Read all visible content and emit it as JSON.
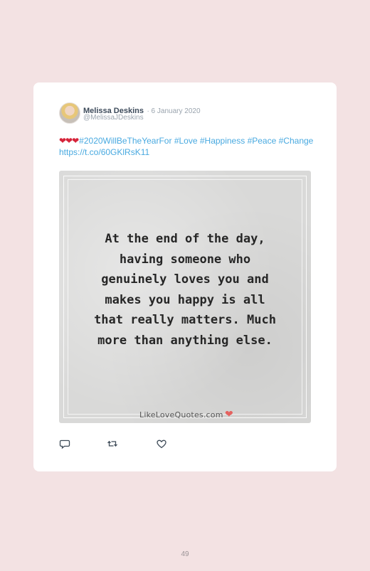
{
  "tweet": {
    "author_name": "Melissa Deskins",
    "date": "· 6 January 2020",
    "handle": "@MelissaJDeskins",
    "hearts": "❤❤❤",
    "hashtags": [
      "#2020WillBeTheYearFor",
      "#Love",
      "#Happiness",
      "#Peace",
      "#Change"
    ],
    "link": "https://t.co/60GKlRsK11",
    "avatar_icon": "avatar-photo"
  },
  "media": {
    "quote_lines": [
      "At the end of the day,",
      "having someone who",
      "genuinely loves you and",
      "makes you happy is all",
      "that really matters. Much",
      "more than anything else."
    ],
    "watermark": "LikeLoveQuotes.com",
    "watermark_heart_color": "#e4625f"
  },
  "actions": {
    "reply_icon": "reply-icon",
    "retweet_icon": "retweet-icon",
    "like_icon": "like-icon"
  },
  "colors": {
    "background": "#f3e2e3",
    "link": "#48a9e0",
    "hearts": "#d6243a"
  },
  "footer": {
    "page_number": "49"
  }
}
